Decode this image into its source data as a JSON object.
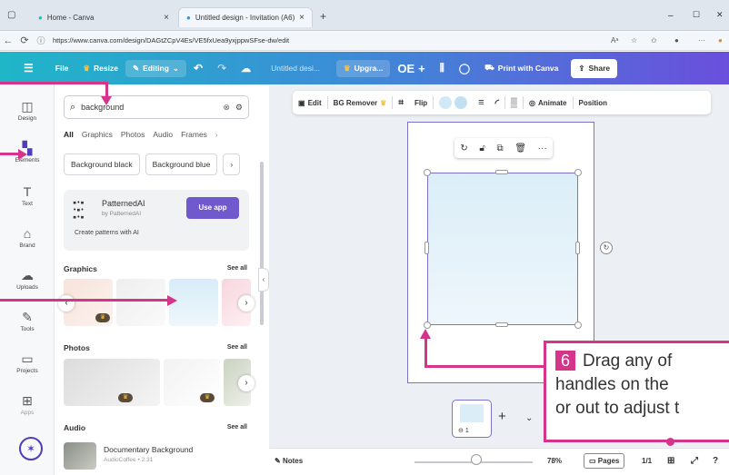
{
  "browser": {
    "tabs": [
      {
        "label": "Home - Canva"
      },
      {
        "label": "Untitled design - Invitation (A6)"
      }
    ],
    "url": "https://www.canva.com/design/DAGtZCpV4Es/VE5fxUea9yxjppwSFse-dw/edit",
    "window_controls": {
      "min": "–",
      "max": "☐",
      "close": "✕"
    }
  },
  "toolbar": {
    "file": "File",
    "resize": "Resize",
    "editing": "Editing",
    "title": "Untitled desi...",
    "upgrade": "Upgra...",
    "avatar": "OE",
    "print": "Print with Canva",
    "share": "Share"
  },
  "rail": [
    {
      "label": "Design",
      "icon": "layout-icon"
    },
    {
      "label": "Elements",
      "icon": "elements-icon"
    },
    {
      "label": "Text",
      "icon": "text-icon"
    },
    {
      "label": "Brand",
      "icon": "brand-icon"
    },
    {
      "label": "Uploads",
      "icon": "upload-icon"
    },
    {
      "label": "Tools",
      "icon": "tools-icon"
    },
    {
      "label": "Projects",
      "icon": "folder-icon"
    },
    {
      "label": "Apps",
      "icon": "apps-icon"
    }
  ],
  "panel": {
    "search_value": "background",
    "tabs": [
      "All",
      "Graphics",
      "Photos",
      "Audio",
      "Frames"
    ],
    "chips": [
      "Background black",
      "Background blue"
    ],
    "promo": {
      "name": "PatternedAI",
      "by": "by PatternedAI",
      "desc": "Create patterns with AI",
      "button": "Use app"
    },
    "graphics_heading": "Graphics",
    "photos_heading": "Photos",
    "audio_heading": "Audio",
    "see_all": "See all",
    "audio_item": {
      "title": "Documentary Background",
      "meta": "AudioCoffee • 2:31"
    }
  },
  "context_toolbar": {
    "edit": "Edit",
    "bg_remover": "BG Remover",
    "flip": "Flip",
    "animate": "Animate",
    "position": "Position"
  },
  "bottom": {
    "notes": "Notes",
    "zoom": "78%",
    "pages": "Pages",
    "page_count": "1/1",
    "thumb_number": "1"
  },
  "callout": {
    "number": "6",
    "lines": [
      "Drag any of",
      "handles on the",
      "or out to adjust t"
    ]
  },
  "colors": {
    "accent": "#d6338a",
    "selection": "#7b73c9",
    "canva_purple": "#4d3fb8"
  }
}
